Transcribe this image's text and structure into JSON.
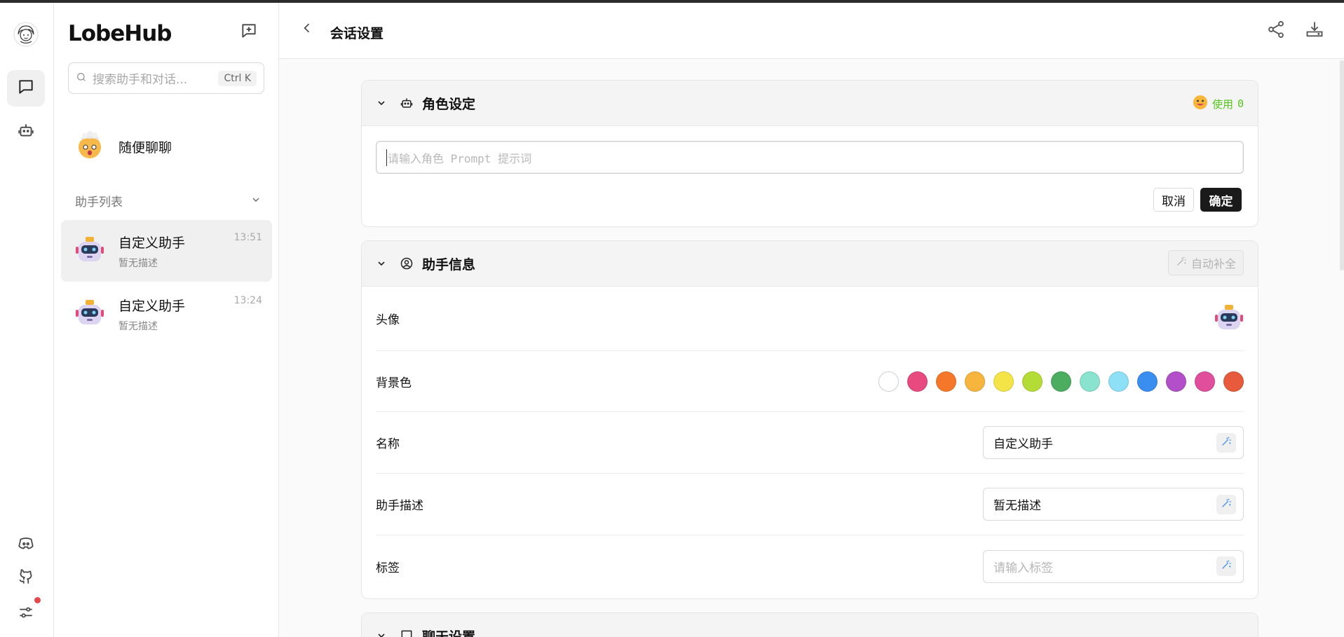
{
  "app": {
    "brand": "LobeHub"
  },
  "search": {
    "placeholder": "搜索助手和对话...",
    "shortcut": "Ctrl K"
  },
  "sessions": {
    "random_chat": "随便聊聊",
    "section_title": "助手列表",
    "items": [
      {
        "name": "自定义助手",
        "desc": "暂无描述",
        "time": "13:51"
      },
      {
        "name": "自定义助手",
        "desc": "暂无描述",
        "time": "13:24"
      }
    ]
  },
  "header": {
    "title": "会话设置"
  },
  "role_card": {
    "title": "角色设定",
    "usage_label": "使用",
    "usage_count": "0",
    "prompt_placeholder": "请输入角色 Prompt 提示词",
    "cancel_label": "取消",
    "ok_label": "确定"
  },
  "info_card": {
    "title": "助手信息",
    "autofill_label": "自动补全",
    "avatar_label": "头像",
    "bg_label": "背景色",
    "name_label": "名称",
    "name_value": "自定义助手",
    "desc_label": "助手描述",
    "desc_value": "暂无描述",
    "tags_label": "标签",
    "tags_placeholder": "请输入标签",
    "swatches": [
      "#ffffff",
      "#e84a7f",
      "#f5782a",
      "#f7b53e",
      "#f5e447",
      "#b4dc36",
      "#4cad61",
      "#8ae3cf",
      "#8ee0f7",
      "#3a8ef0",
      "#b34fc9",
      "#e04e9c",
      "#e85a3c"
    ]
  },
  "chat_card": {
    "title": "聊天设置"
  }
}
